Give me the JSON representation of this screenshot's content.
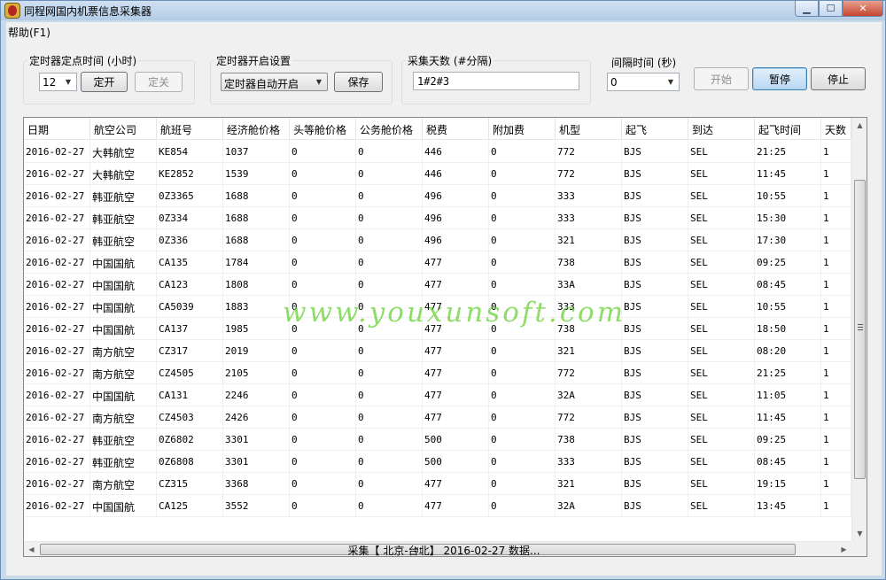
{
  "window": {
    "title": "同程网国内机票信息采集器"
  },
  "menu": {
    "help": "帮助(F1)"
  },
  "timer_point": {
    "label": "定时器定点时间 (小时)",
    "hour_value": "12",
    "on_button": "定开",
    "off_button": "定关"
  },
  "timer_start": {
    "label": "定时器开启设置",
    "mode_value": "定时器自动开启",
    "save_button": "保存"
  },
  "collect_days": {
    "label": "采集天数 (#分隔)",
    "value": "1#2#3"
  },
  "interval": {
    "label": "间隔时间 (秒)",
    "value": "0"
  },
  "actions": {
    "start": "开始",
    "pause": "暂停",
    "stop": "停止"
  },
  "table": {
    "columns": [
      "日期",
      "航空公司",
      "航班号",
      "经济舱价格",
      "头等舱价格",
      "公务舱价格",
      "税费",
      "附加费",
      "机型",
      "起飞",
      "到达",
      "起飞时间",
      "天数"
    ],
    "rows": [
      [
        "2016-02-27",
        "大韩航空",
        "KE854",
        "1037",
        "0",
        "0",
        "446",
        "0",
        "772",
        "BJS",
        "SEL",
        "21:25",
        "1"
      ],
      [
        "2016-02-27",
        "大韩航空",
        "KE2852",
        "1539",
        "0",
        "0",
        "446",
        "0",
        "772",
        "BJS",
        "SEL",
        "11:45",
        "1"
      ],
      [
        "2016-02-27",
        "韩亚航空",
        "0Z3365",
        "1688",
        "0",
        "0",
        "496",
        "0",
        "333",
        "BJS",
        "SEL",
        "10:55",
        "1"
      ],
      [
        "2016-02-27",
        "韩亚航空",
        "0Z334",
        "1688",
        "0",
        "0",
        "496",
        "0",
        "333",
        "BJS",
        "SEL",
        "15:30",
        "1"
      ],
      [
        "2016-02-27",
        "韩亚航空",
        "0Z336",
        "1688",
        "0",
        "0",
        "496",
        "0",
        "321",
        "BJS",
        "SEL",
        "17:30",
        "1"
      ],
      [
        "2016-02-27",
        "中国国航",
        "CA135",
        "1784",
        "0",
        "0",
        "477",
        "0",
        "738",
        "BJS",
        "SEL",
        "09:25",
        "1"
      ],
      [
        "2016-02-27",
        "中国国航",
        "CA123",
        "1808",
        "0",
        "0",
        "477",
        "0",
        "33A",
        "BJS",
        "SEL",
        "08:45",
        "1"
      ],
      [
        "2016-02-27",
        "中国国航",
        "CA5039",
        "1883",
        "0",
        "0",
        "477",
        "0",
        "333",
        "BJS",
        "SEL",
        "10:55",
        "1"
      ],
      [
        "2016-02-27",
        "中国国航",
        "CA137",
        "1985",
        "0",
        "0",
        "477",
        "0",
        "738",
        "BJS",
        "SEL",
        "18:50",
        "1"
      ],
      [
        "2016-02-27",
        "南方航空",
        "CZ317",
        "2019",
        "0",
        "0",
        "477",
        "0",
        "321",
        "BJS",
        "SEL",
        "08:20",
        "1"
      ],
      [
        "2016-02-27",
        "南方航空",
        "CZ4505",
        "2105",
        "0",
        "0",
        "477",
        "0",
        "772",
        "BJS",
        "SEL",
        "21:25",
        "1"
      ],
      [
        "2016-02-27",
        "中国国航",
        "CA131",
        "2246",
        "0",
        "0",
        "477",
        "0",
        "32A",
        "BJS",
        "SEL",
        "11:05",
        "1"
      ],
      [
        "2016-02-27",
        "南方航空",
        "CZ4503",
        "2426",
        "0",
        "0",
        "477",
        "0",
        "772",
        "BJS",
        "SEL",
        "11:45",
        "1"
      ],
      [
        "2016-02-27",
        "韩亚航空",
        "0Z6802",
        "3301",
        "0",
        "0",
        "500",
        "0",
        "738",
        "BJS",
        "SEL",
        "09:25",
        "1"
      ],
      [
        "2016-02-27",
        "韩亚航空",
        "0Z6808",
        "3301",
        "0",
        "0",
        "500",
        "0",
        "333",
        "BJS",
        "SEL",
        "08:45",
        "1"
      ],
      [
        "2016-02-27",
        "南方航空",
        "CZ315",
        "3368",
        "0",
        "0",
        "477",
        "0",
        "321",
        "BJS",
        "SEL",
        "19:15",
        "1"
      ],
      [
        "2016-02-27",
        "中国国航",
        "CA125",
        "3552",
        "0",
        "0",
        "477",
        "0",
        "32A",
        "BJS",
        "SEL",
        "13:45",
        "1"
      ]
    ]
  },
  "watermark": "www.youxunsoft.com",
  "status": "采集【 北京-台北】 2016-02-27 数据..."
}
